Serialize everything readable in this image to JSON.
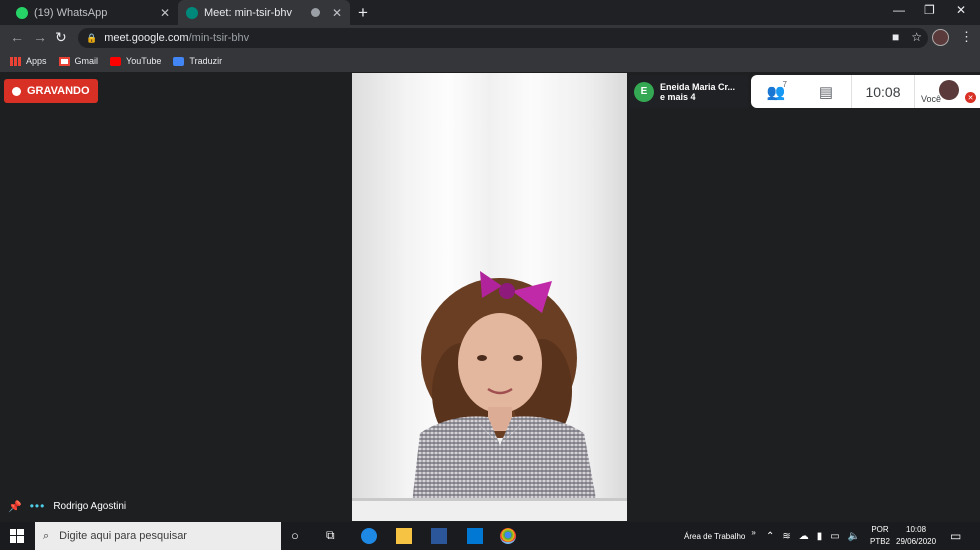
{
  "browser": {
    "tabs": [
      {
        "title": "(19) WhatsApp",
        "favicon": "whatsapp-icon"
      },
      {
        "title": "Meet: min-tsir-bhv",
        "favicon": "meet-icon"
      }
    ],
    "url_host": "meet.google.com",
    "url_path": "/min-tsir-bhv"
  },
  "bookmarks": [
    {
      "label": "Apps",
      "icon": "apps-grid-icon"
    },
    {
      "label": "Gmail",
      "icon": "gmail-icon"
    },
    {
      "label": "YouTube",
      "icon": "youtube-icon"
    },
    {
      "label": "Traduzir",
      "icon": "translate-icon"
    }
  ],
  "meet": {
    "recording_label": "GRAVANDO",
    "participant_name": "Eneida Maria Cr...",
    "participant_more": "e mais 4",
    "participant_initial": "E",
    "people_count": "7",
    "clock": "10:08",
    "self_label": "Você",
    "presenter_name": "Rodrigo Agostini"
  },
  "taskbar": {
    "search_placeholder": "Digite aqui para pesquisar",
    "desktop_label": "Área de Trabalho",
    "lang_top": "POR",
    "lang_bottom": "PTB2",
    "time": "10:08",
    "date": "29/06/2020"
  },
  "colors": {
    "recording": "#d93025",
    "meet_bg": "#1e1f21",
    "avatar_green": "#34a853"
  }
}
